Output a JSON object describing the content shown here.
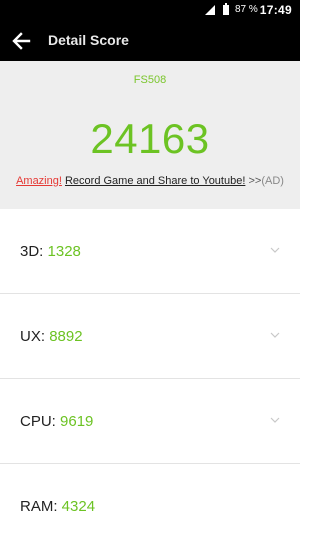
{
  "status": {
    "battery_percent": "87 %",
    "time": "17:49"
  },
  "appbar": {
    "title": "Detail Score"
  },
  "hero": {
    "device": "FS508",
    "total_score": "24163",
    "promo_prefix": "Amazing!",
    "promo_text": "Record Game and Share to Youtube!",
    "promo_arrows": ">>",
    "promo_ad": "(AD)"
  },
  "scores": [
    {
      "label": "3D:",
      "value": "1328",
      "expandable": true
    },
    {
      "label": "UX:",
      "value": "8892",
      "expandable": true
    },
    {
      "label": "CPU:",
      "value": "9619",
      "expandable": true
    },
    {
      "label": "RAM:",
      "value": "4324",
      "expandable": false
    }
  ],
  "colors": {
    "accent_green": "#6cc323",
    "promo_red": "#e53935",
    "header_bg": "#000000",
    "hero_bg": "#eeeeee"
  }
}
